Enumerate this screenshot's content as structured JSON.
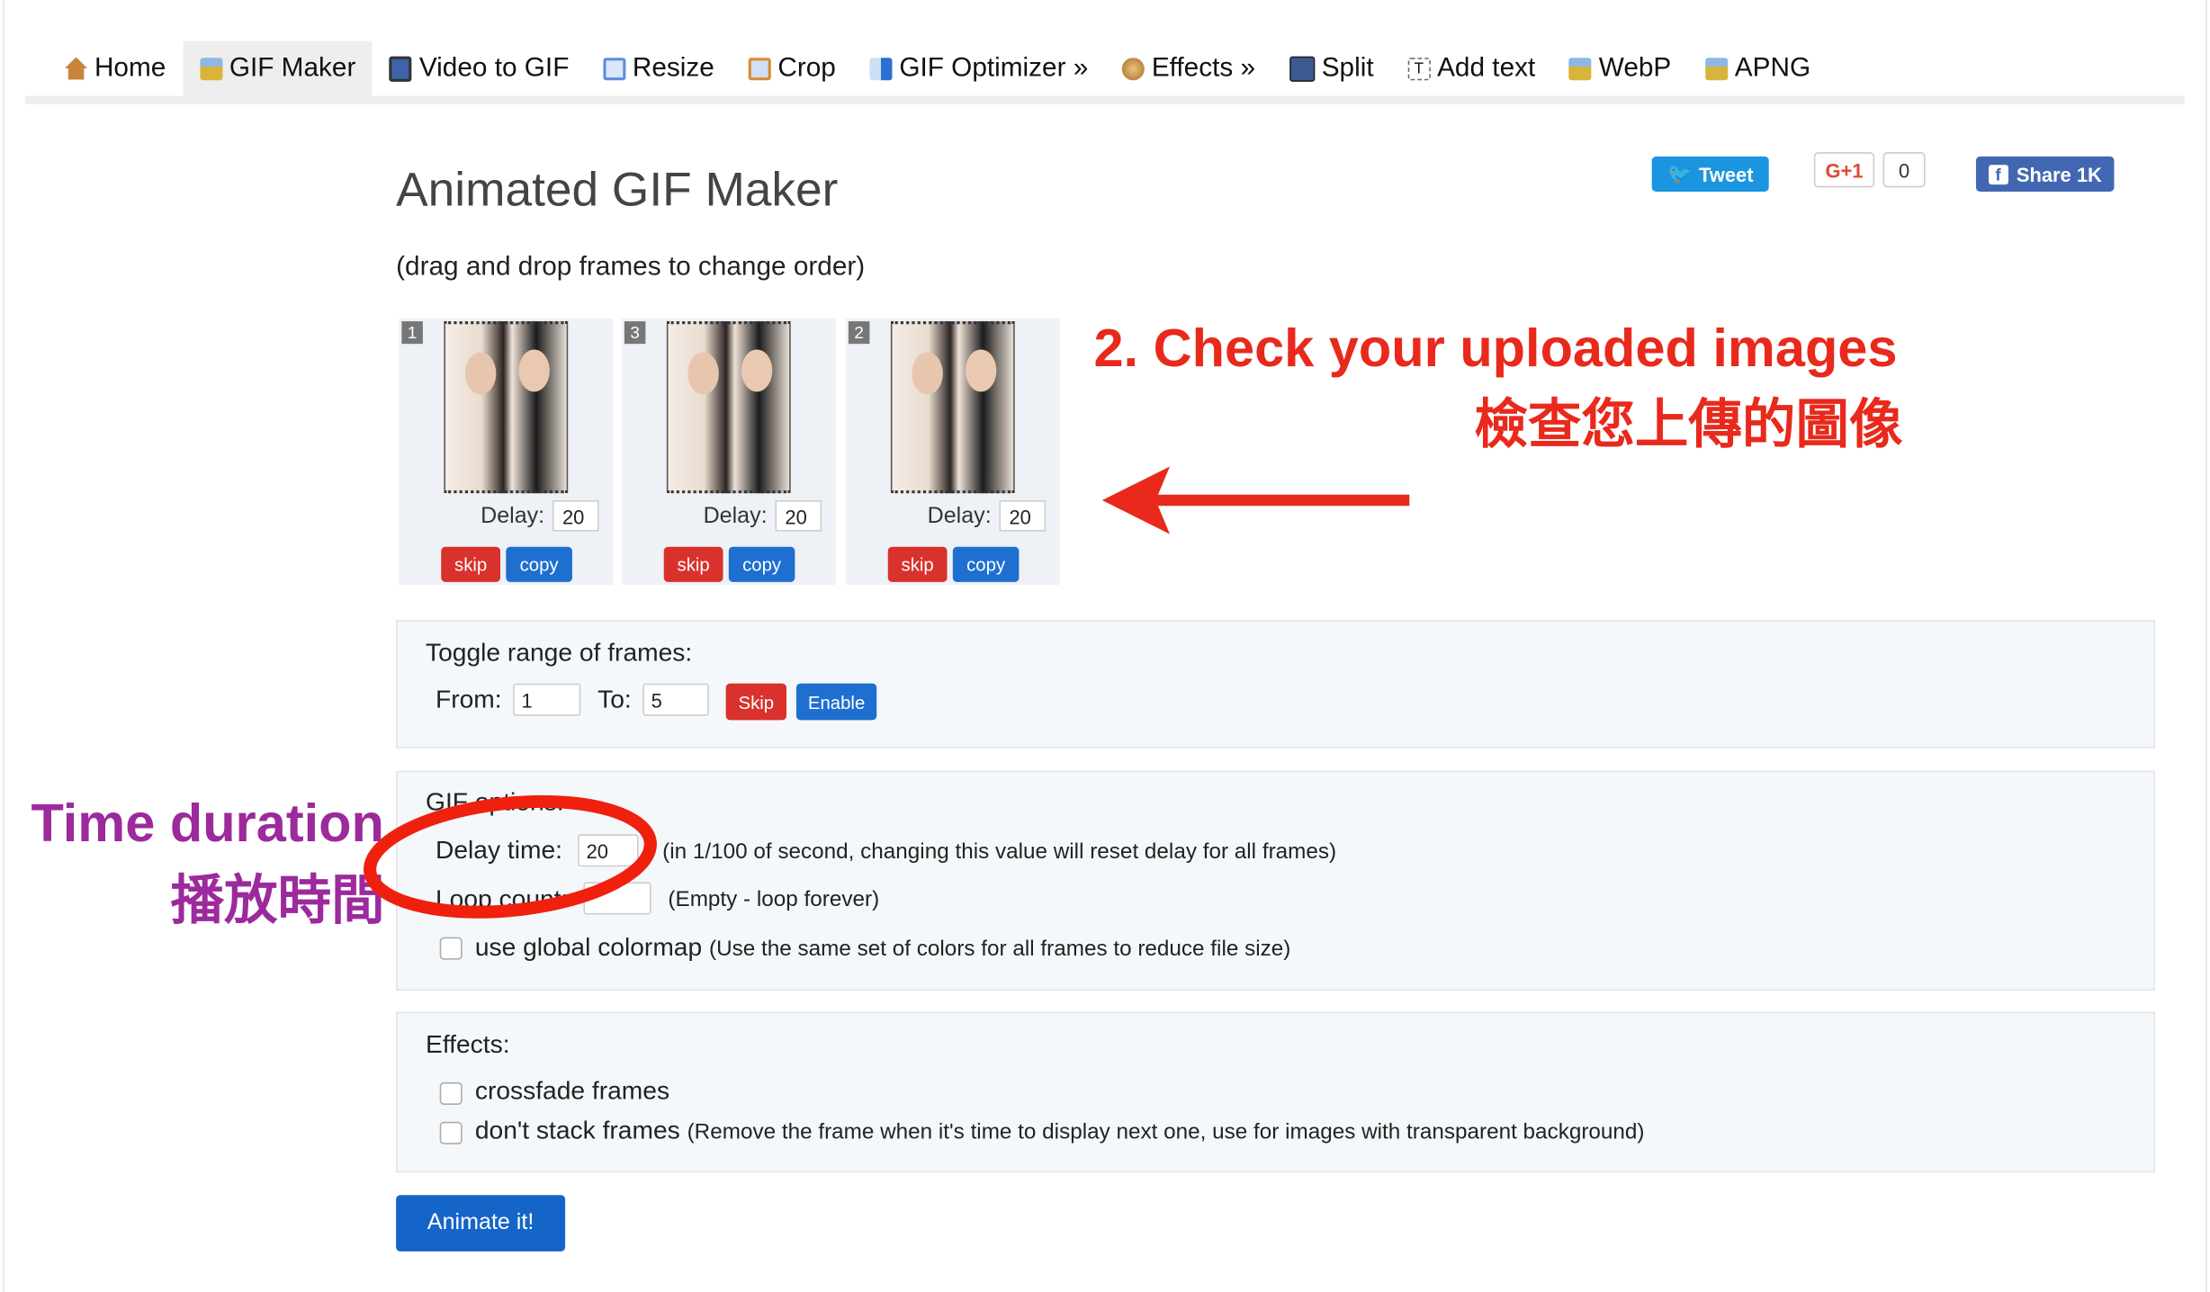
{
  "nav": {
    "items": [
      {
        "label": "Home",
        "icon": "home-icon",
        "color": "#c8843a"
      },
      {
        "label": "GIF Maker",
        "icon": "gif-maker-icon",
        "color": "#d9b43a",
        "active": true
      },
      {
        "label": "Video to GIF",
        "icon": "film-icon",
        "color": "#3f63a8"
      },
      {
        "label": "Resize",
        "icon": "resize-icon",
        "color": "#5b8ee0"
      },
      {
        "label": "Crop",
        "icon": "crop-icon",
        "color": "#d88a3a"
      },
      {
        "label": "GIF Optimizer »",
        "icon": "optimizer-icon",
        "color": "#4a90e2"
      },
      {
        "label": "Effects »",
        "icon": "effects-icon",
        "color": "#c9954a"
      },
      {
        "label": "Split",
        "icon": "split-icon",
        "color": "#3a5a90"
      },
      {
        "label": "Add text",
        "icon": "add-text-icon",
        "color": "#888888"
      },
      {
        "label": "WebP",
        "icon": "webp-icon",
        "color": "#d9b43a"
      },
      {
        "label": "APNG",
        "icon": "apng-icon",
        "color": "#d9b43a"
      }
    ]
  },
  "header": {
    "title": "Animated GIF Maker",
    "subtitle": "(drag and drop frames to change order)"
  },
  "social": {
    "tweet": "Tweet",
    "gplus": "G+1",
    "gplus_count": "0",
    "share": "Share 1K",
    "tweet_color": "#1b95e0",
    "share_color": "#4267b2"
  },
  "frames": [
    {
      "number": "1",
      "delay_label": "Delay:",
      "delay": "20",
      "skip": "skip",
      "copy": "copy"
    },
    {
      "number": "3",
      "delay_label": "Delay:",
      "delay": "20",
      "skip": "skip",
      "copy": "copy"
    },
    {
      "number": "2",
      "delay_label": "Delay:",
      "delay": "20",
      "skip": "skip",
      "copy": "copy"
    }
  ],
  "toggle": {
    "title": "Toggle range of frames:",
    "from_label": "From:",
    "from": "1",
    "to_label": "To:",
    "to": "5",
    "skip": "Skip",
    "enable": "Enable"
  },
  "options": {
    "title": "GIF options:",
    "delay_label": "Delay time:",
    "delay": "20",
    "delay_hint": "(in 1/100 of second, changing this value will reset delay for all frames)",
    "loop_label": "Loop count:",
    "loop": "",
    "loop_hint": "(Empty - loop forever)",
    "colormap_label": "use global colormap",
    "colormap_hint": "(Use the same set of colors for all frames to reduce file size)",
    "colormap_checked": false
  },
  "effects": {
    "title": "Effects:",
    "crossfade_label": "crossfade frames",
    "crossfade_checked": false,
    "nostack_label": "don't stack frames",
    "nostack_hint": "(Remove the frame when it's time to display next one, use for images with transparent background)",
    "nostack_checked": false
  },
  "animate_button": "Animate it!",
  "annotations": {
    "check_en": "2. Check your uploaded images",
    "check_zh": "檢查您上傳的圖像",
    "time_en": "Time duration",
    "time_zh": "播放時間",
    "red": "#e8291c",
    "purple": "#9c2a9c"
  }
}
